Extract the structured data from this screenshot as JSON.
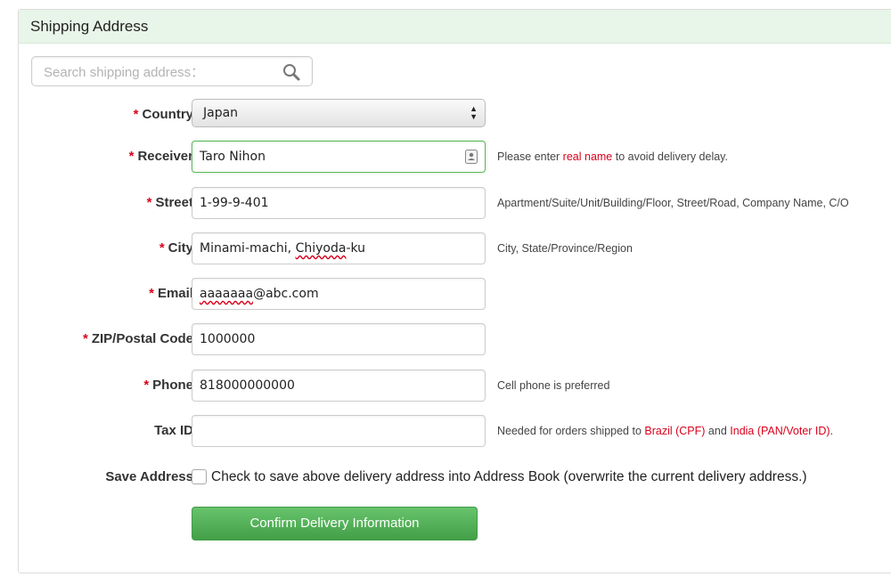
{
  "header": {
    "title": "Shipping Address"
  },
  "search": {
    "placeholder": "Search shipping address："
  },
  "form": {
    "country": {
      "label": "Country",
      "value": "Japan"
    },
    "receiver": {
      "label": "Receiver",
      "value": "Taro Nihon",
      "hint_before": "Please enter ",
      "hint_red": "real name",
      "hint_after": " to avoid delivery delay."
    },
    "street": {
      "label": "Street",
      "value": "1-99-9-401",
      "hint": "Apartment/Suite/Unit/Building/Floor, Street/Road, Company Name, C/O"
    },
    "city": {
      "label": "City",
      "value_before": "Minami-machi, ",
      "value_spell": "Chiyoda",
      "value_after": "-ku",
      "hint": "City, State/Province/Region"
    },
    "email": {
      "label": "Email",
      "value_spell": "aaaaaaa",
      "value_after": "@abc.com"
    },
    "zip": {
      "label": "ZIP/Postal Code",
      "value": "1000000"
    },
    "phone": {
      "label": "Phone",
      "value": "818000000000",
      "hint": "Cell phone is preferred"
    },
    "tax": {
      "label": "Tax ID",
      "value": "",
      "hint_before": "Needed for orders shipped to ",
      "hint_red1": "Brazil (CPF)",
      "hint_mid": " and ",
      "hint_red2": "India (PAN/Voter ID)",
      "hint_after": "."
    },
    "save": {
      "label": "Save Address",
      "text": "Check to save above delivery address into Address Book (overwrite the current delivery address.)"
    },
    "required_mark": "*"
  },
  "confirm_button": {
    "label": "Confirm Delivery Information"
  },
  "colors": {
    "required": "#d9001b",
    "header_bg": "#e8f5e9",
    "button": "#4caf50"
  }
}
